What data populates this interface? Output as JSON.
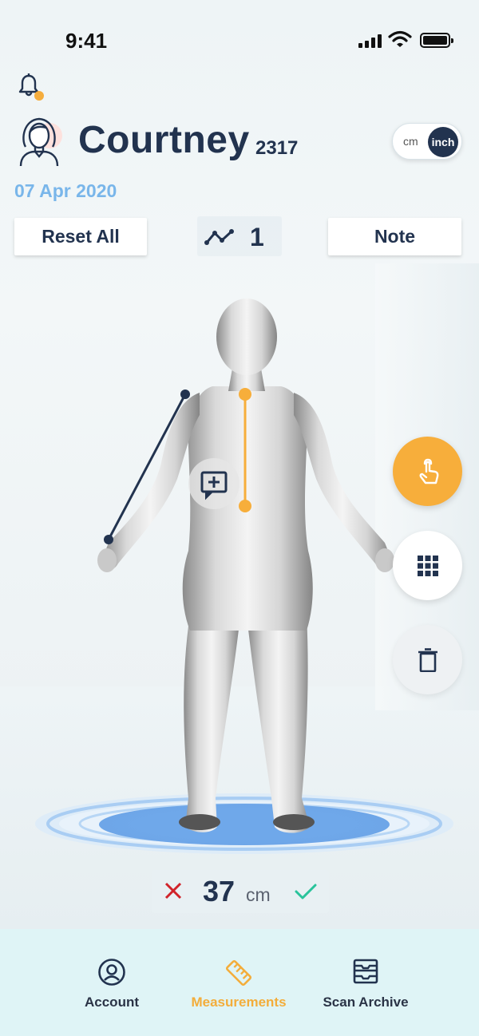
{
  "status_bar": {
    "time": "9:41"
  },
  "header": {
    "user_name": "Courtney",
    "user_id": "2317",
    "date": "07 Apr 2020",
    "unit_toggle": {
      "option_cm": "cm",
      "option_inch": "inch",
      "selected": "inch"
    }
  },
  "toolbar": {
    "reset_label": "Reset All",
    "count_value": "1",
    "note_label": "Note"
  },
  "measurement": {
    "value": "37",
    "unit": "cm"
  },
  "nav": {
    "items": [
      {
        "label": "Account",
        "icon": "account-icon",
        "active": false
      },
      {
        "label": "Measurements",
        "icon": "ruler-icon",
        "active": true
      },
      {
        "label": "Scan Archive",
        "icon": "archive-icon",
        "active": false
      }
    ]
  },
  "colors": {
    "accent": "#f7ae3b",
    "primary": "#22334f",
    "date": "#79b6ea",
    "platform": "#6ea9ea",
    "nav_bg": "#dff4f6"
  }
}
